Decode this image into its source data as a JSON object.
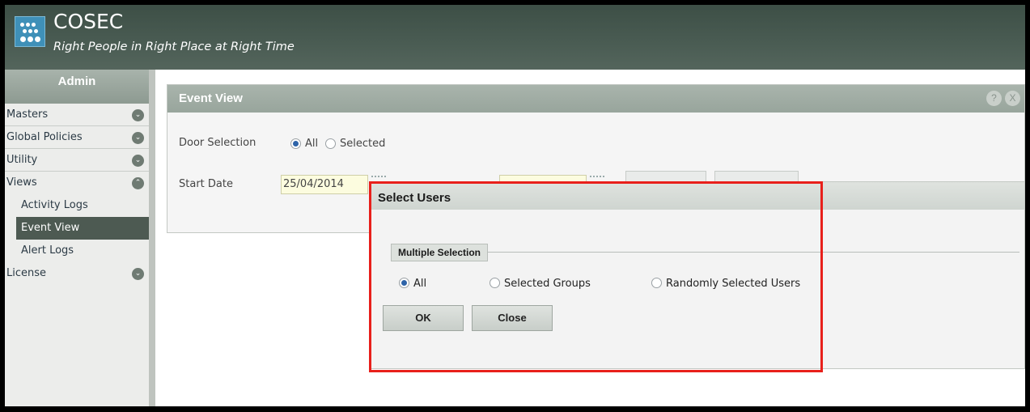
{
  "app": {
    "brand": "COSEC",
    "tagline": "Right People in Right Place at Right Time"
  },
  "sidebar": {
    "title": "Admin",
    "items": [
      {
        "label": "Masters"
      },
      {
        "label": "Global Policies"
      },
      {
        "label": "Utility"
      },
      {
        "label": "Views"
      }
    ],
    "sub_items": [
      {
        "label": "Activity Logs"
      },
      {
        "label": "Event View"
      },
      {
        "label": "Alert Logs"
      }
    ],
    "license": "License"
  },
  "panel": {
    "title": "Event View",
    "help": "?",
    "close": "X",
    "door_selection_label": "Door Selection",
    "door_options": [
      "All",
      "Selected"
    ],
    "start_date_label": "Start Date",
    "start_date_value": "25/04/2014"
  },
  "dialog": {
    "title": "Select Users",
    "legend": "Multiple Selection",
    "options": [
      "All",
      "Selected Groups",
      "Randomly Selected Users"
    ],
    "ok_label": "OK",
    "close_label": "Close"
  },
  "colors": {
    "header": "#4a5c53",
    "highlight": "#e8201b",
    "radio_selected": "#2d63a8"
  }
}
